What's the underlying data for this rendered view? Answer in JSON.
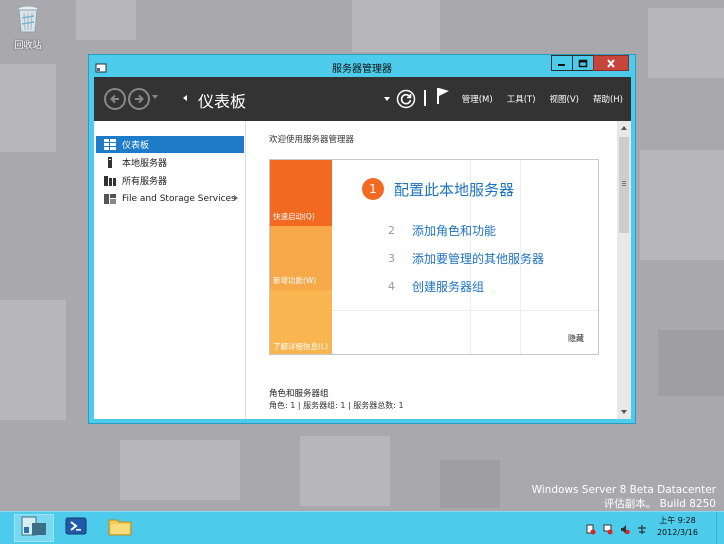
{
  "desktop": {
    "recycle_bin_label": "回收站",
    "watermark_line1": "Windows Server 8 Beta Datacenter",
    "watermark_line2": "评估副本。 Build 8250"
  },
  "window": {
    "title": "服务器管理器",
    "accent_color": "#4ccbea"
  },
  "header": {
    "breadcrumb": "仪表板",
    "menu": [
      "管理(M)",
      "工具(T)",
      "视图(V)",
      "帮助(H)"
    ]
  },
  "sidebar": {
    "items": [
      {
        "label": "仪表板",
        "icon": "dashboard-icon",
        "active": true
      },
      {
        "label": "本地服务器",
        "icon": "server-icon",
        "active": false
      },
      {
        "label": "所有服务器",
        "icon": "servers-icon",
        "active": false
      },
      {
        "label": "File and Storage Services",
        "icon": "storage-icon",
        "active": false
      }
    ]
  },
  "main": {
    "welcome": "欢迎使用服务器管理器",
    "tiles": [
      "快速启动(Q)",
      "新增功能(W)",
      "了解详细信息(L)"
    ],
    "steps": [
      {
        "num": "1",
        "label": "配置此本地服务器"
      },
      {
        "num": "2",
        "label": "添加角色和功能"
      },
      {
        "num": "3",
        "label": "添加要管理的其他服务器"
      },
      {
        "num": "4",
        "label": "创建服务器组"
      }
    ],
    "hide_label": "隐藏",
    "section_title": "角色和服务器组",
    "section_stats": "角色: 1 | 服务器组: 1 | 服务器总数: 1"
  },
  "taskbar": {
    "clock_time": "上午 9:28",
    "clock_date": "2012/3/16"
  }
}
